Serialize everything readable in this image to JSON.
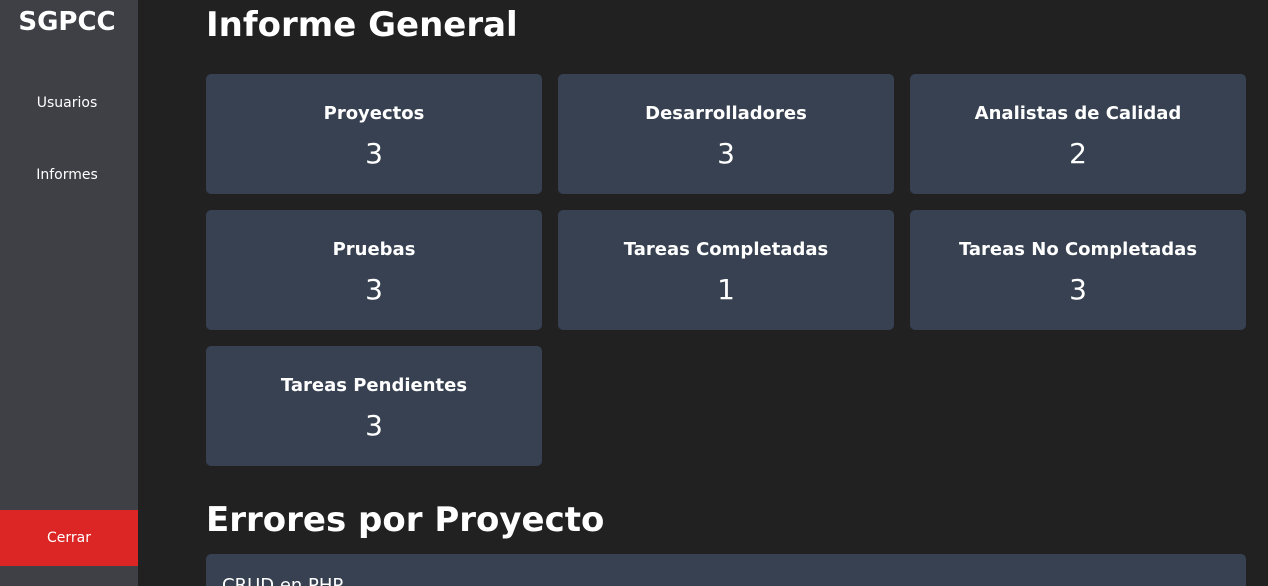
{
  "sidebar": {
    "brand": "SGPCC",
    "items": [
      {
        "label": "Usuarios"
      },
      {
        "label": "Informes"
      }
    ],
    "logout_label": "Cerrar"
  },
  "main": {
    "title": "Informe General",
    "cards": [
      {
        "label": "Proyectos",
        "value": "3"
      },
      {
        "label": "Desarrolladores",
        "value": "3"
      },
      {
        "label": "Analistas de Calidad",
        "value": "2"
      },
      {
        "label": "Pruebas",
        "value": "3"
      },
      {
        "label": "Tareas Completadas",
        "value": "1"
      },
      {
        "label": "Tareas No Completadas",
        "value": "3"
      },
      {
        "label": "Tareas Pendientes",
        "value": "3"
      }
    ],
    "errors_section": {
      "title": "Errores por Proyecto",
      "projects": [
        {
          "name": "CRUD en PHP"
        }
      ]
    }
  },
  "colors": {
    "background": "#212121",
    "sidebar": "#3f3f46",
    "card": "#374151",
    "logout": "#dc2626",
    "text": "#ffffff"
  }
}
